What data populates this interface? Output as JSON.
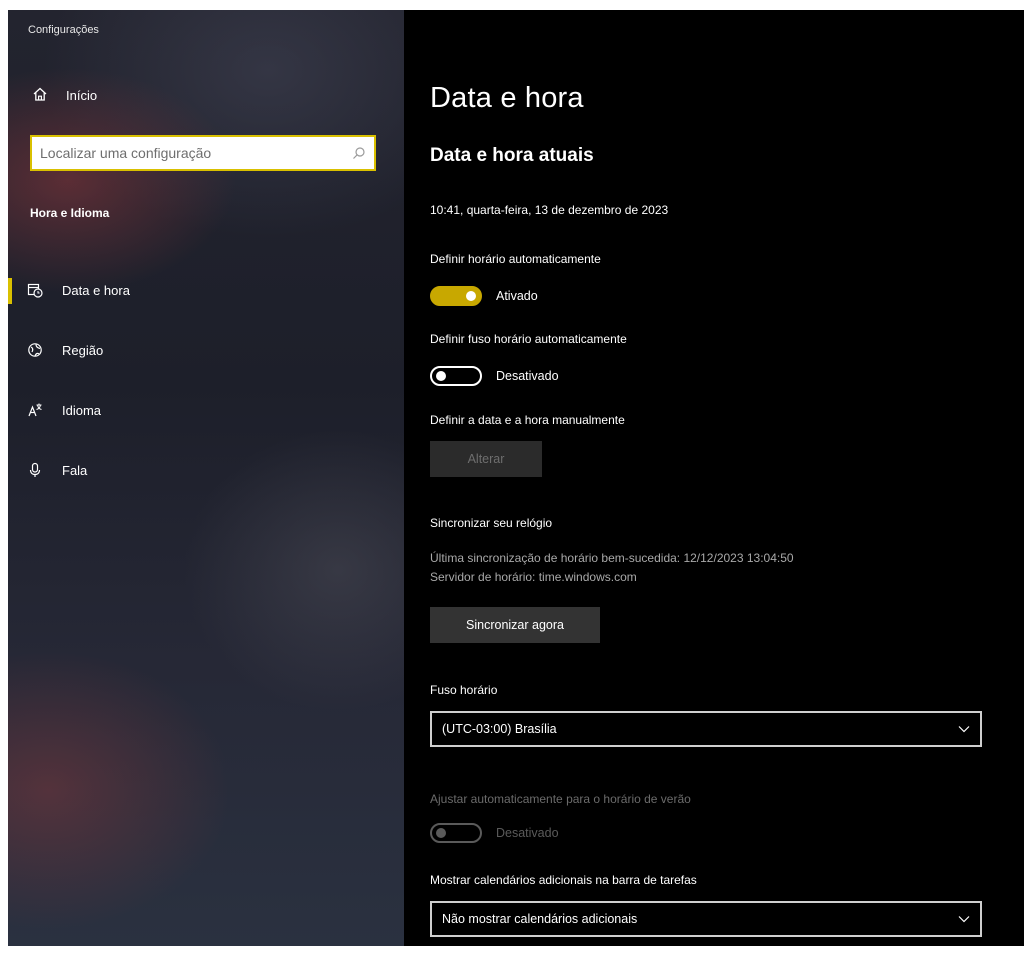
{
  "window": {
    "title": "Configurações"
  },
  "sidebar": {
    "home_label": "Início",
    "search": {
      "placeholder": "Localizar uma configuração",
      "value": ""
    },
    "section_title": "Hora e Idioma",
    "items": [
      {
        "label": "Data e hora",
        "icon": "calendar-clock-icon",
        "active": true
      },
      {
        "label": "Região",
        "icon": "globe-icon",
        "active": false
      },
      {
        "label": "Idioma",
        "icon": "language-icon",
        "active": false
      },
      {
        "label": "Fala",
        "icon": "microphone-icon",
        "active": false
      }
    ]
  },
  "main": {
    "title": "Data e hora",
    "subtitle": "Data e hora atuais",
    "current_datetime": "10:41, quarta-feira, 13 de dezembro de 2023",
    "auto_time": {
      "label": "Definir horário automaticamente",
      "state": "Ativado",
      "on": true
    },
    "auto_timezone": {
      "label": "Definir fuso horário automaticamente",
      "state": "Desativado",
      "on": false
    },
    "manual": {
      "label": "Definir a data e a hora manualmente",
      "button": "Alterar",
      "enabled": false
    },
    "sync": {
      "title": "Sincronizar seu relógio",
      "last_sync": "Última sincronização de horário bem-sucedida: 12/12/2023 13:04:50",
      "server": "Servidor de horário: time.windows.com",
      "button": "Sincronizar agora"
    },
    "timezone": {
      "label": "Fuso horário",
      "value": "(UTC-03:00) Brasília"
    },
    "dst": {
      "label": "Ajustar automaticamente para o horário de verão",
      "state": "Desativado",
      "on": false,
      "enabled": false
    },
    "calendars": {
      "label": "Mostrar calendários adicionais na barra de tarefas",
      "value": "Não mostrar calendários adicionais"
    }
  },
  "colors": {
    "accent": "#c8a800",
    "search_border": "#d9c000",
    "background": "#000000"
  }
}
